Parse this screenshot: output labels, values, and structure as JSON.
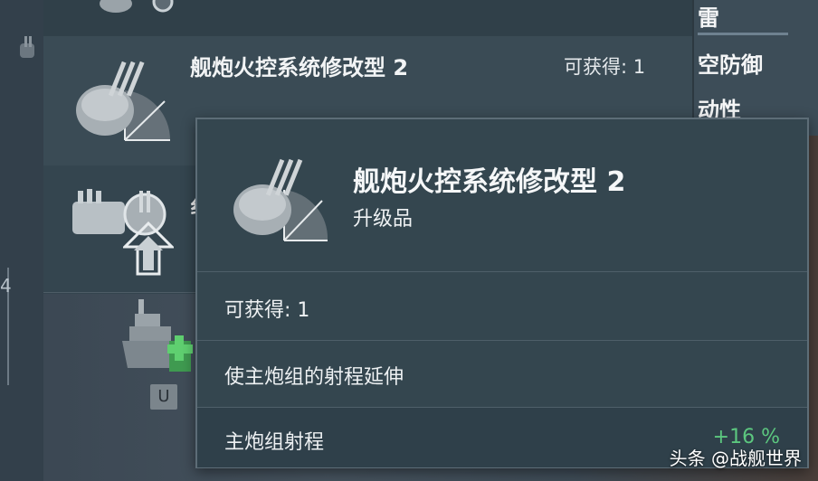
{
  "background_list": {
    "rows": [
      {
        "title": "",
        "count": ""
      },
      {
        "title": "舰炮火控系统修改型 2",
        "count": "可获得: 1"
      },
      {
        "title": "纟",
        "count": ""
      }
    ]
  },
  "right_stats": [
    {
      "label": "雷"
    },
    {
      "label": "空防御"
    },
    {
      "label": "动性"
    }
  ],
  "left_panel": {
    "bracket_label": "4"
  },
  "ship_badge": "U",
  "tooltip": {
    "title": "舰炮火控系统修改型 2",
    "subtitle": "升级品",
    "available": "可获得: 1",
    "description": "使主炮组的射程延伸",
    "stat_label": "主炮组射程",
    "stat_value": "+16 %"
  },
  "watermark": "头条 @战舰世界",
  "colors": {
    "positive": "#5cc77f",
    "panel": "#34464f",
    "border": "#5d6d77"
  },
  "icons": [
    "gun-turret-icon",
    "range-quadrant-icon",
    "upgrade-arrow-icon",
    "ship-icon",
    "plus-icon"
  ]
}
